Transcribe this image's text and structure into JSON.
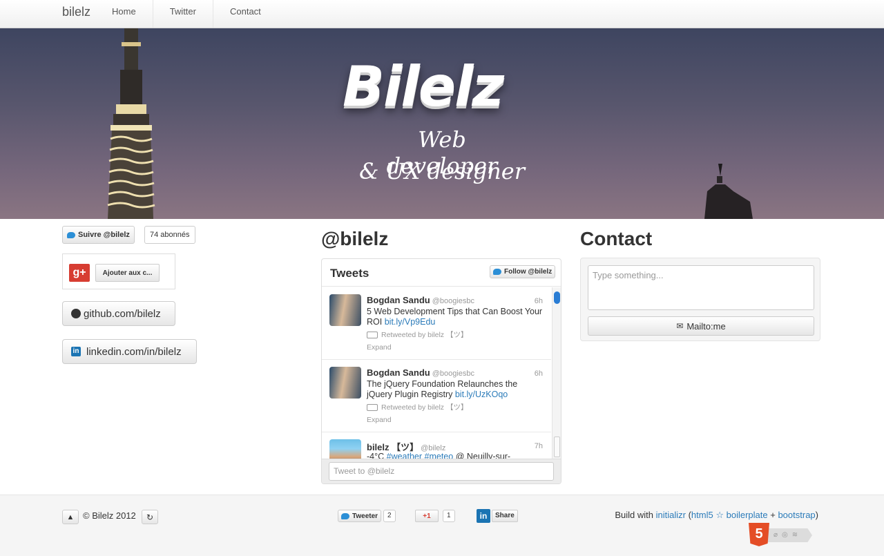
{
  "nav": {
    "brand": "bilelz",
    "links": [
      "Home",
      "Twitter",
      "Contact"
    ]
  },
  "hero": {
    "title": "Bilelz",
    "subtitle_line1": "Web developer",
    "subtitle_line2": "& UX designer"
  },
  "social": {
    "twitter_follow": "Suivre @bilelz",
    "twitter_followers": "74 abonnés",
    "gplus_label": "Ajouter aux c...",
    "github": "github.com/bilelz",
    "linkedin": "linkedin.com/in/bilelz"
  },
  "twitter": {
    "heading": "@bilelz",
    "widget_title": "Tweets",
    "follow_button": "Follow @bilelz",
    "tweets": [
      {
        "name": "Bogdan Sandu",
        "handle": "@boogiesbc",
        "time": "6h",
        "text": "5 Web Development Tips that Can Boost Your ROI",
        "link": "bit.ly/Vp9Edu",
        "retweet": "Retweeted by bilelz 【ツ】",
        "expand": "Expand"
      },
      {
        "name": "Bogdan Sandu",
        "handle": "@boogiesbc",
        "time": "6h",
        "text": "The jQuery Foundation Relaunches the jQuery Plugin Registry",
        "link": "bit.ly/UzKOqo",
        "retweet": "Retweeted by bilelz 【ツ】",
        "expand": "Expand"
      },
      {
        "name": "bilelz 【ツ】",
        "handle": "@bilelz",
        "time": "7h",
        "text": "-4°C",
        "link": "#weather #meteo",
        "tail": "@ Neuilly-sur-"
      }
    ],
    "tweet_placeholder": "Tweet to @bilelz"
  },
  "contact": {
    "heading": "Contact",
    "textarea_placeholder": "Type something...",
    "mailto_label": "Mailto:me"
  },
  "footer": {
    "copyright": "© Bilelz 2012",
    "tweeter_label": "Tweeter",
    "tweeter_count": "2",
    "gplus_label": "+1",
    "gplus_count": "1",
    "linkedin_share": "Share",
    "build_prefix": "Build with",
    "initializr": "initializr",
    "html5": "html5",
    "star": "☆",
    "boilerplate": "boilerplate",
    "plus": "+",
    "bootstrap": "bootstrap"
  },
  "colors": {
    "link": "#2b7bb9",
    "twitter_blue": "#2c8fd6",
    "gplus_red": "#d73d32",
    "linkedin_blue": "#1b74b3",
    "html5_orange": "#e44d26"
  }
}
